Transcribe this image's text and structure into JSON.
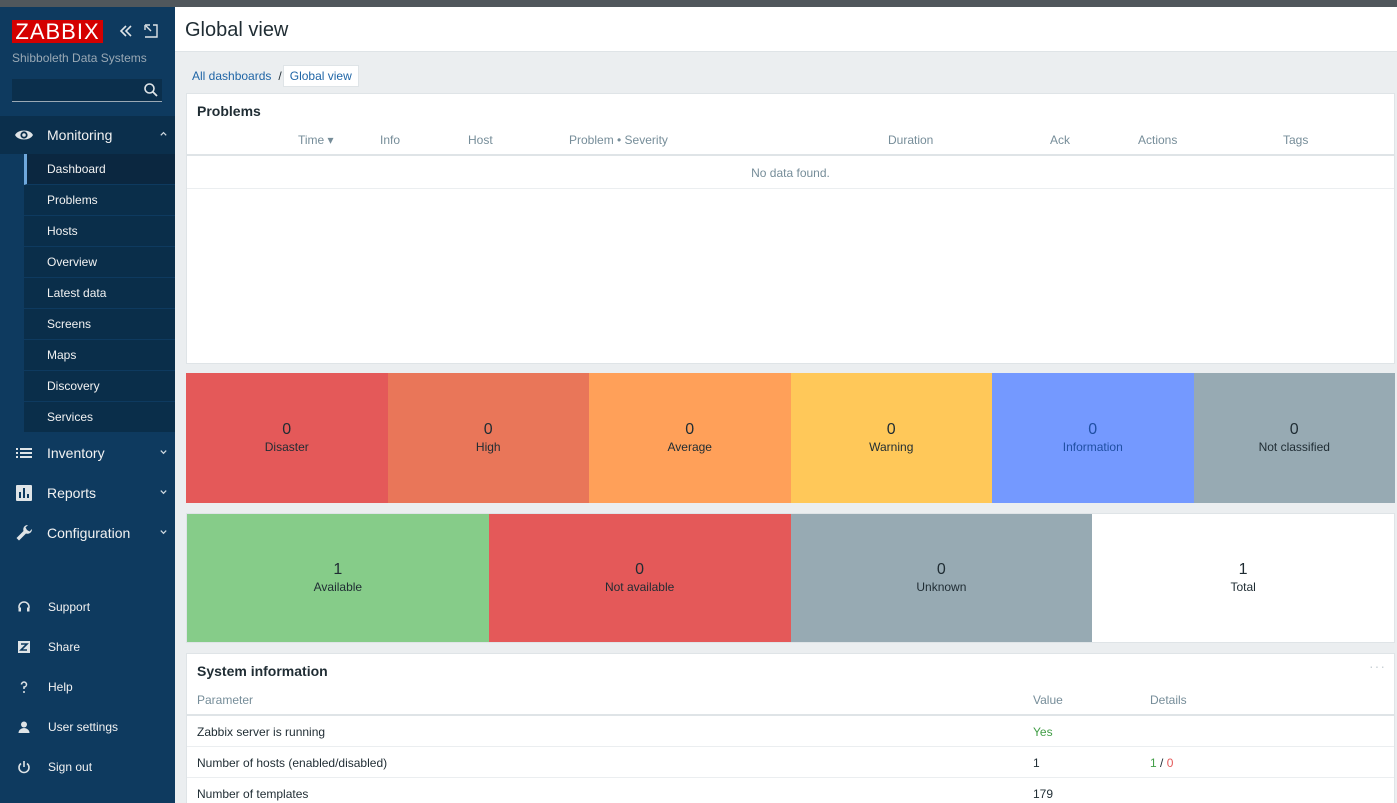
{
  "app": {
    "logo": "ZABBIX",
    "subtitle": "Shibboleth Data Systems",
    "search_placeholder": ""
  },
  "sidebar": {
    "sections": [
      {
        "label": "Monitoring",
        "icon": "eye-icon",
        "expanded": true
      },
      {
        "label": "Inventory",
        "icon": "list-icon",
        "expanded": false
      },
      {
        "label": "Reports",
        "icon": "bar-chart-icon",
        "expanded": false
      },
      {
        "label": "Configuration",
        "icon": "wrench-icon",
        "expanded": false
      }
    ],
    "monitoring_items": [
      "Dashboard",
      "Problems",
      "Hosts",
      "Overview",
      "Latest data",
      "Screens",
      "Maps",
      "Discovery",
      "Services"
    ],
    "active_item": "Dashboard",
    "footer": [
      {
        "label": "Support",
        "icon": "headset-icon"
      },
      {
        "label": "Share",
        "icon": "share-z-icon"
      },
      {
        "label": "Help",
        "icon": "question-icon"
      },
      {
        "label": "User settings",
        "icon": "user-icon"
      },
      {
        "label": "Sign out",
        "icon": "power-icon"
      }
    ]
  },
  "page": {
    "title": "Global view",
    "breadcrumb": {
      "parent": "All dashboards",
      "separator": "/",
      "current": "Global view"
    }
  },
  "problems": {
    "title": "Problems",
    "columns": {
      "time": "Time ▾",
      "info": "Info",
      "host": "Host",
      "problem": "Problem • Severity",
      "duration": "Duration",
      "ack": "Ack",
      "actions": "Actions",
      "tags": "Tags"
    },
    "empty": "No data found."
  },
  "severity": [
    {
      "count": "0",
      "label": "Disaster",
      "color": "#e45959"
    },
    {
      "count": "0",
      "label": "High",
      "color": "#e97659"
    },
    {
      "count": "0",
      "label": "Average",
      "color": "#ffa059"
    },
    {
      "count": "0",
      "label": "Warning",
      "color": "#ffc859"
    },
    {
      "count": "0",
      "label": "Information",
      "color": "#7499ff"
    },
    {
      "count": "0",
      "label": "Not classified",
      "color": "#97aab3"
    }
  ],
  "host_availability": [
    {
      "count": "1",
      "label": "Available",
      "color": "#86cc89"
    },
    {
      "count": "0",
      "label": "Not available",
      "color": "#e45959"
    },
    {
      "count": "0",
      "label": "Unknown",
      "color": "#97aab3"
    },
    {
      "count": "1",
      "label": "Total",
      "color": "#ffffff"
    }
  ],
  "system_info": {
    "title": "System information",
    "columns": {
      "parameter": "Parameter",
      "value": "Value",
      "details": "Details"
    },
    "rows": [
      {
        "parameter": "Zabbix server is running",
        "value": "Yes",
        "details_enabled": "",
        "details_sep": "",
        "details_disabled": ""
      },
      {
        "parameter": "Number of hosts (enabled/disabled)",
        "value": "1",
        "details_enabled": "1",
        "details_sep": " / ",
        "details_disabled": "0"
      },
      {
        "parameter": "Number of templates",
        "value": "179",
        "details_enabled": "",
        "details_sep": "",
        "details_disabled": ""
      }
    ]
  }
}
